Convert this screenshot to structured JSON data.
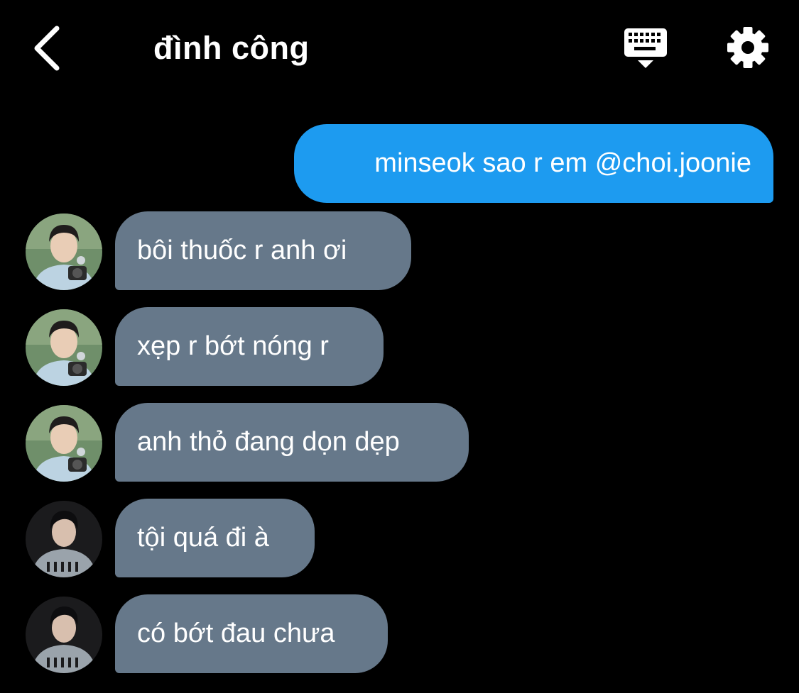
{
  "header": {
    "title": "đình công",
    "back_icon": "chevron-left-icon",
    "keyboard_icon": "keyboard-icon",
    "settings_icon": "gear-icon"
  },
  "colors": {
    "background": "#000000",
    "outgoing_bubble": "#1d9bf0",
    "incoming_bubble": "#66788a",
    "text": "#ffffff"
  },
  "messages": [
    {
      "direction": "outgoing",
      "text": "minseok sao r em @choi.joonie"
    },
    {
      "direction": "incoming",
      "sender_avatar": "avatar-user-a",
      "text": "bôi thuốc r anh ơi"
    },
    {
      "direction": "incoming",
      "sender_avatar": "avatar-user-a",
      "text": "xẹp r bớt nóng r"
    },
    {
      "direction": "incoming",
      "sender_avatar": "avatar-user-a",
      "text": "anh thỏ đang dọn dẹp"
    },
    {
      "direction": "incoming",
      "sender_avatar": "avatar-user-b",
      "text": "tội quá đi à"
    },
    {
      "direction": "incoming",
      "sender_avatar": "avatar-user-b",
      "text": "có bớt đau chưa"
    }
  ]
}
